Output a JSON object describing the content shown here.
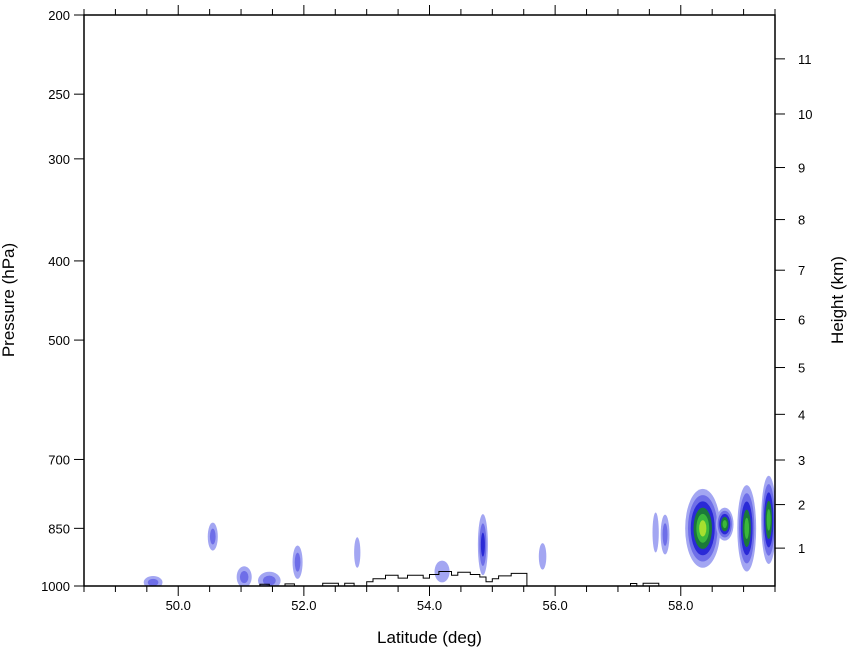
{
  "chart_data": {
    "type": "heatmap",
    "title": "",
    "xlabel": "Latitude (deg)",
    "ylabel": "Pressure (hPa)",
    "y2label": "Height (km)",
    "xlim": [
      48.5,
      59.5
    ],
    "ylim": [
      1000,
      200
    ],
    "y_scale": "log",
    "x_ticks": [
      50,
      52,
      54,
      56,
      58
    ],
    "x_tick_labels": [
      "50.0",
      "52.0",
      "54.0",
      "56.0",
      "58.0"
    ],
    "x_minor_step": 0.5,
    "y_ticks": [
      200,
      250,
      300,
      400,
      500,
      700,
      850,
      1000
    ],
    "y_tick_labels": [
      "200",
      "250",
      "300",
      "400",
      "500",
      "700",
      "850",
      "1000"
    ],
    "y2_ticks": [
      1,
      2,
      3,
      4,
      5,
      6,
      7,
      8,
      9,
      10,
      11
    ],
    "y2_tick_labels": [
      "1",
      "2",
      "3",
      "4",
      "5",
      "6",
      "7",
      "8",
      "9",
      "10",
      "11"
    ],
    "grid": false,
    "colors": {
      "level1": "#a3a6f2",
      "level2": "#6e6ee8",
      "level3": "#2a2ad6",
      "level4": "#1b7a3a",
      "level5": "#3bb83b",
      "level6": "#a6e02f",
      "terrain": "#000000"
    },
    "blobs": [
      {
        "lat": 49.6,
        "p": 990,
        "dlat": 0.15,
        "dp": 18,
        "levels": 2
      },
      {
        "lat": 50.55,
        "p": 870,
        "dlat": 0.08,
        "dp": 35,
        "levels": 2
      },
      {
        "lat": 51.05,
        "p": 975,
        "dlat": 0.12,
        "dp": 30,
        "levels": 2
      },
      {
        "lat": 51.45,
        "p": 985,
        "dlat": 0.18,
        "dp": 25,
        "levels": 2
      },
      {
        "lat": 51.9,
        "p": 935,
        "dlat": 0.08,
        "dp": 45,
        "levels": 2
      },
      {
        "lat": 52.85,
        "p": 910,
        "dlat": 0.05,
        "dp": 40,
        "levels": 1
      },
      {
        "lat": 54.2,
        "p": 960,
        "dlat": 0.12,
        "dp": 30,
        "levels": 1
      },
      {
        "lat": 54.85,
        "p": 890,
        "dlat": 0.08,
        "dp": 80,
        "levels": 3
      },
      {
        "lat": 55.8,
        "p": 920,
        "dlat": 0.06,
        "dp": 35,
        "levels": 1
      },
      {
        "lat": 57.6,
        "p": 860,
        "dlat": 0.05,
        "dp": 50,
        "levels": 1
      },
      {
        "lat": 57.75,
        "p": 865,
        "dlat": 0.07,
        "dp": 50,
        "levels": 2
      },
      {
        "lat": 58.35,
        "p": 850,
        "dlat": 0.28,
        "dp": 100,
        "levels": 6
      },
      {
        "lat": 58.7,
        "p": 840,
        "dlat": 0.14,
        "dp": 40,
        "levels": 5
      },
      {
        "lat": 59.05,
        "p": 850,
        "dlat": 0.15,
        "dp": 110,
        "levels": 5
      },
      {
        "lat": 59.4,
        "p": 830,
        "dlat": 0.12,
        "dp": 110,
        "levels": 5
      }
    ],
    "terrain_profile": [
      [
        48.5,
        1000
      ],
      [
        51.3,
        1000
      ],
      [
        51.3,
        995
      ],
      [
        51.45,
        995
      ],
      [
        51.45,
        1000
      ],
      [
        51.7,
        1000
      ],
      [
        51.7,
        994
      ],
      [
        51.85,
        994
      ],
      [
        51.85,
        1000
      ],
      [
        52.3,
        1000
      ],
      [
        52.3,
        992
      ],
      [
        52.55,
        992
      ],
      [
        52.55,
        1000
      ],
      [
        52.65,
        1000
      ],
      [
        52.65,
        992
      ],
      [
        52.8,
        992
      ],
      [
        52.8,
        1000
      ],
      [
        53.0,
        1000
      ],
      [
        53.0,
        988
      ],
      [
        53.1,
        988
      ],
      [
        53.1,
        980
      ],
      [
        53.3,
        980
      ],
      [
        53.3,
        970
      ],
      [
        53.5,
        970
      ],
      [
        53.5,
        978
      ],
      [
        53.65,
        978
      ],
      [
        53.65,
        970
      ],
      [
        53.9,
        970
      ],
      [
        53.9,
        978
      ],
      [
        54.0,
        978
      ],
      [
        54.0,
        968
      ],
      [
        54.15,
        968
      ],
      [
        54.15,
        960
      ],
      [
        54.35,
        960
      ],
      [
        54.35,
        970
      ],
      [
        54.45,
        970
      ],
      [
        54.45,
        962
      ],
      [
        54.65,
        962
      ],
      [
        54.65,
        968
      ],
      [
        54.8,
        968
      ],
      [
        54.8,
        975
      ],
      [
        54.9,
        975
      ],
      [
        54.9,
        988
      ],
      [
        55.0,
        988
      ],
      [
        55.0,
        980
      ],
      [
        55.1,
        980
      ],
      [
        55.1,
        972
      ],
      [
        55.3,
        972
      ],
      [
        55.3,
        965
      ],
      [
        55.55,
        965
      ],
      [
        55.55,
        1000
      ],
      [
        57.2,
        1000
      ],
      [
        57.2,
        993
      ],
      [
        57.3,
        993
      ],
      [
        57.3,
        1000
      ],
      [
        57.4,
        1000
      ],
      [
        57.4,
        992
      ],
      [
        57.65,
        992
      ],
      [
        57.65,
        1000
      ],
      [
        59.5,
        1000
      ]
    ]
  }
}
